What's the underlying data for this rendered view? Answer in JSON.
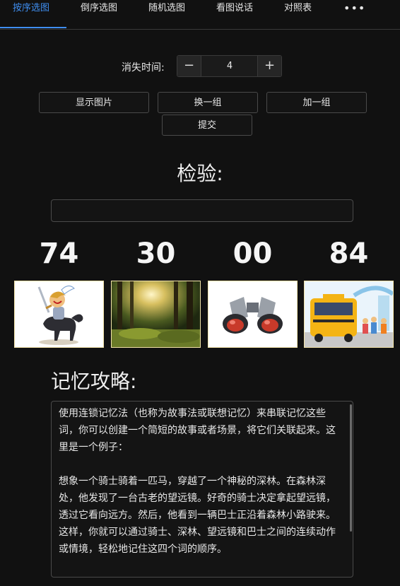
{
  "tabs": [
    "按序选图",
    "倒序选图",
    "随机选图",
    "看图说话",
    "对照表"
  ],
  "tab_more": "•••",
  "active_tab": "按序选图",
  "disappear": {
    "label": "消失时间:",
    "value": "4",
    "minus": "−",
    "plus": "+"
  },
  "buttons": {
    "show": "显示图片",
    "change": "换一组",
    "add": "加一组",
    "submit": "提交"
  },
  "check_title": "检验:",
  "numbers": [
    "74",
    "30",
    "00",
    "84"
  ],
  "images": [
    "knight-on-horse",
    "forest",
    "binoculars",
    "school-bus"
  ],
  "strategy_title": "记忆攻略:",
  "strategy_text": "使用连锁记忆法（也称为故事法或联想记忆）来串联记忆这些词，你可以创建一个简短的故事或者场景，将它们关联起来。这里是一个例子：\n\n想象一个骑士骑着一匹马，穿越了一个神秘的深林。在森林深处，他发现了一台古老的望远镜。好奇的骑士决定拿起望远镜，透过它看向远方。然后，他看到一辆巴士正沿着森林小路驶来。这样，你就可以通过骑士、深林、望远镜和巴士之间的连续动作或情境，轻松地记住这四个词的顺序。",
  "colors": {
    "accent": "#3f8ef0",
    "background": "#111111"
  }
}
